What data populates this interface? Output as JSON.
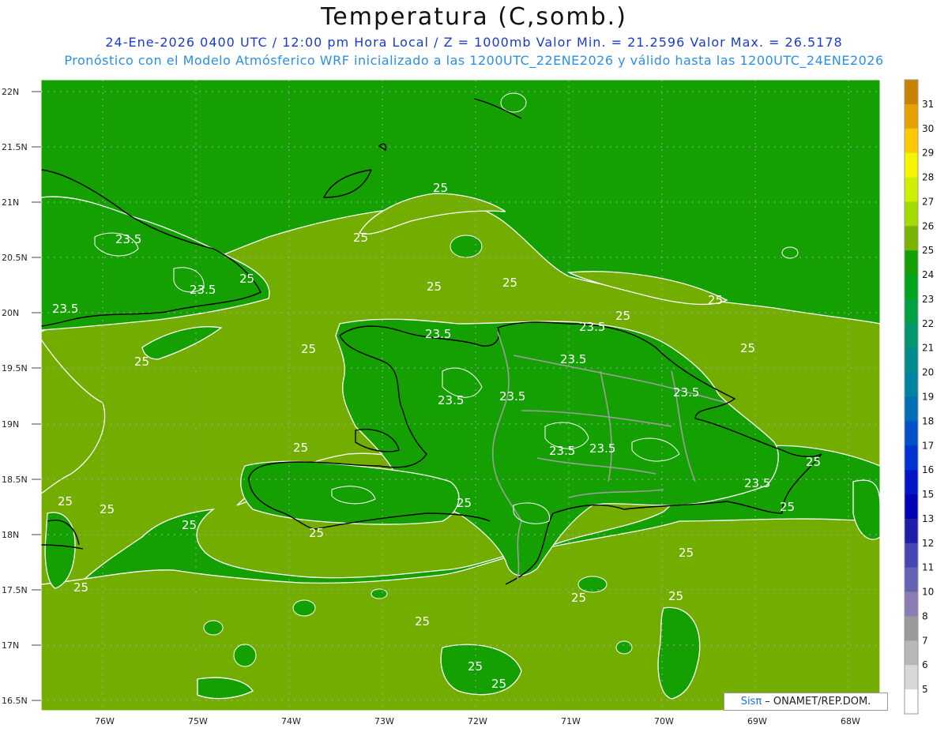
{
  "title": "Temperatura (C,somb.)",
  "subtitle_line1": "24-Ene-2026 0400 UTC / 12:00 pm Hora Local / Z = 1000mb   Valor Min. = 21.2596   Valor Max. = 26.5178",
  "subtitle_line2": "Pronóstico con el Modelo Atmósferico WRF inicializado a las 1200UTC_22ENE2026 y válido hasta las  1200UTC_24ENE2026",
  "credit": {
    "brand": "Sisπ",
    "rest": " – ONAMET/REP.DOM."
  },
  "map": {
    "lat_labels": [
      "22N",
      "21.5N",
      "21N",
      "20.5N",
      "20N",
      "19.5N",
      "19N",
      "18.5N",
      "18N",
      "17.5N",
      "17N",
      "16.5N"
    ],
    "lon_labels": [
      "76W",
      "75W",
      "74W",
      "73W",
      "72W",
      "71W",
      "70W",
      "69W",
      "68W"
    ],
    "colors": {
      "sea_warm": "#72ad00",
      "land_cool": "#13a000",
      "contour": "#ffffff",
      "coast": "#000000",
      "border": "#999999"
    },
    "contour_labels": [
      {
        "text": "25"
      },
      {
        "text": "25"
      },
      {
        "text": "25"
      },
      {
        "text": "25"
      },
      {
        "text": "25"
      },
      {
        "text": "25"
      },
      {
        "text": "25"
      },
      {
        "text": "25"
      },
      {
        "text": "25"
      },
      {
        "text": "25"
      },
      {
        "text": "25"
      },
      {
        "text": "25"
      },
      {
        "text": "25"
      },
      {
        "text": "25"
      },
      {
        "text": "25"
      },
      {
        "text": "25"
      },
      {
        "text": "25"
      },
      {
        "text": "25"
      },
      {
        "text": "25"
      },
      {
        "text": "25"
      },
      {
        "text": "25"
      },
      {
        "text": "25"
      },
      {
        "text": "25"
      },
      {
        "text": "25"
      },
      {
        "text": "25"
      },
      {
        "text": "23.5"
      },
      {
        "text": "23.5"
      },
      {
        "text": "23.5"
      },
      {
        "text": "23.5"
      },
      {
        "text": "23.5"
      },
      {
        "text": "23.5"
      },
      {
        "text": "23.5"
      },
      {
        "text": "23.5"
      },
      {
        "text": "23.5"
      },
      {
        "text": "23.5"
      },
      {
        "text": "23.5"
      },
      {
        "text": "23.5"
      }
    ]
  },
  "colorbar": {
    "levels": [
      "31",
      "30",
      "29",
      "28",
      "27",
      "26",
      "25",
      "24",
      "23",
      "22",
      "21",
      "20",
      "19",
      "18",
      "17",
      "16",
      "15",
      "13",
      "12",
      "11",
      "10",
      "8",
      "7",
      "6",
      "5"
    ],
    "colors": [
      "#c88200",
      "#e6a000",
      "#ffc800",
      "#f5f500",
      "#ccf000",
      "#a0dc00",
      "#78b400",
      "#14a000",
      "#00a51e",
      "#00a046",
      "#00966e",
      "#008c8c",
      "#0082a0",
      "#006eb4",
      "#0050c8",
      "#0032d2",
      "#0014c8",
      "#0000b4",
      "#1e1eaa",
      "#4646b4",
      "#6464b4",
      "#8c7cb4",
      "#9a9a9a",
      "#b8b8b8",
      "#d8d8d8",
      "#ffffff"
    ]
  }
}
